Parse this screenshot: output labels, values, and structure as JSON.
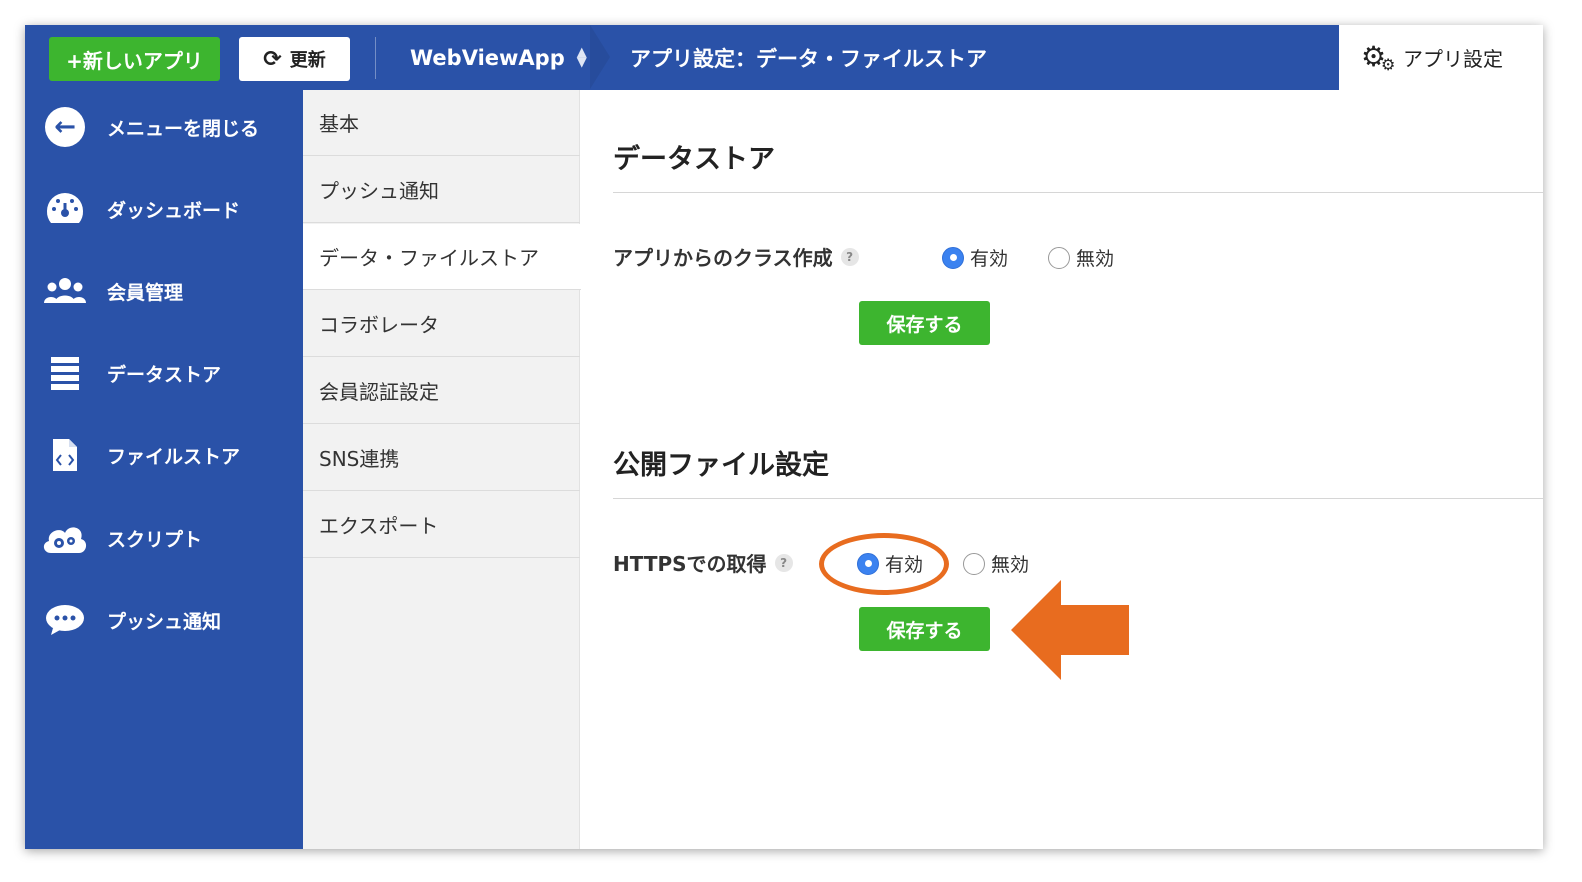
{
  "header": {
    "new_app_label": "+新しいアプリ",
    "refresh_label": "更新",
    "app_name": "WebViewApp",
    "breadcrumb": "アプリ設定：データ・ファイルストア",
    "settings_label": "アプリ設定"
  },
  "sidebar": {
    "items": [
      {
        "label": "メニューを閉じる",
        "icon": "back-arrow-icon"
      },
      {
        "label": "ダッシュボード",
        "icon": "dashboard-gauge-icon"
      },
      {
        "label": "会員管理",
        "icon": "users-icon"
      },
      {
        "label": "データストア",
        "icon": "database-icon"
      },
      {
        "label": "ファイルストア",
        "icon": "file-code-icon"
      },
      {
        "label": "スクリプト",
        "icon": "cloud-gear-icon"
      },
      {
        "label": "プッシュ通知",
        "icon": "chat-bubble-icon"
      }
    ]
  },
  "submenu": {
    "items": [
      {
        "label": "基本"
      },
      {
        "label": "プッシュ通知"
      },
      {
        "label": "データ・ファイルストア",
        "active": true
      },
      {
        "label": "コラボレータ"
      },
      {
        "label": "会員認証設定"
      },
      {
        "label": "SNS連携"
      },
      {
        "label": "エクスポート"
      }
    ]
  },
  "main": {
    "datastore": {
      "title": "データストア",
      "field_label": "アプリからのクラス作成",
      "help": "?",
      "option_on": "有効",
      "option_off": "無効",
      "selected": "有効",
      "save_label": "保存する"
    },
    "public_file": {
      "title": "公開ファイル設定",
      "field_label": "HTTPSでの取得",
      "help": "?",
      "option_on": "有効",
      "option_off": "無効",
      "selected": "有効",
      "save_label": "保存する"
    }
  },
  "colors": {
    "brand_blue": "#2a52a8",
    "button_green": "#3db52f",
    "annotation_orange": "#e86c1f",
    "radio_selected": "#3b82f0"
  }
}
